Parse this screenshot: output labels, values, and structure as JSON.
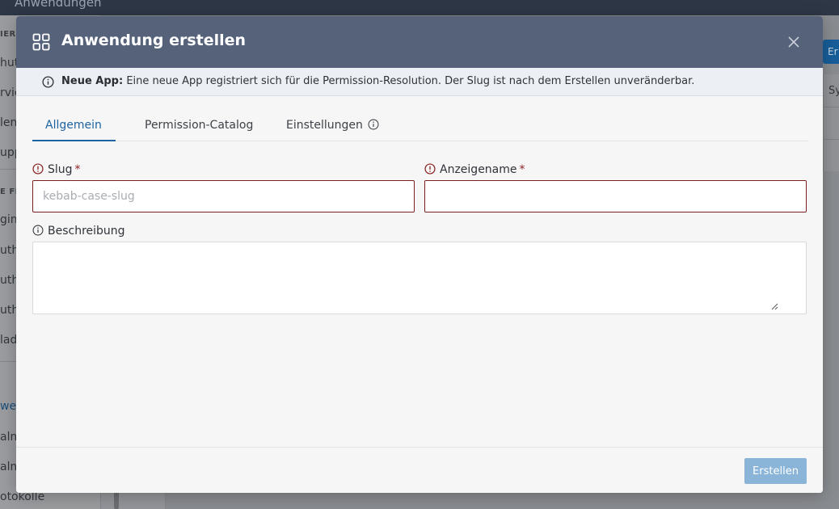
{
  "background": {
    "top_title": "Anwendungen",
    "sidebar": {
      "items": [
        "IERU",
        "hut",
        "rvic",
        "len",
        "upp",
        "E FE",
        "gin-",
        "uth",
        "uth",
        "uth",
        "lad",
        "we",
        "alm",
        "alm",
        "otokolle"
      ]
    },
    "right_button_label": "Er",
    "right_column_header": "Sy"
  },
  "modal": {
    "title": "Anwendung erstellen",
    "banner": {
      "bold": "Neue App:",
      "text": "Eine neue App registriert sich für die Permission-Resolution. Der Slug ist nach dem Erstellen unveränderbar."
    },
    "tabs": [
      {
        "label": "Allgemein"
      },
      {
        "label": "Permission-Catalog"
      },
      {
        "label": "Einstellungen"
      }
    ],
    "fields": {
      "slug": {
        "label": "Slug",
        "required_mark": "*",
        "placeholder": "kebab-case-slug",
        "value": ""
      },
      "display_name": {
        "label": "Anzeigename",
        "required_mark": "*",
        "placeholder": "",
        "value": ""
      },
      "description": {
        "label": "Beschreibung",
        "value": ""
      }
    },
    "footer": {
      "create_label": "Erstellen"
    }
  },
  "colors": {
    "header": "#56617a",
    "accent": "#1e63a2",
    "error": "#7a1f1f",
    "button_disabled": "#8bb5d8"
  }
}
